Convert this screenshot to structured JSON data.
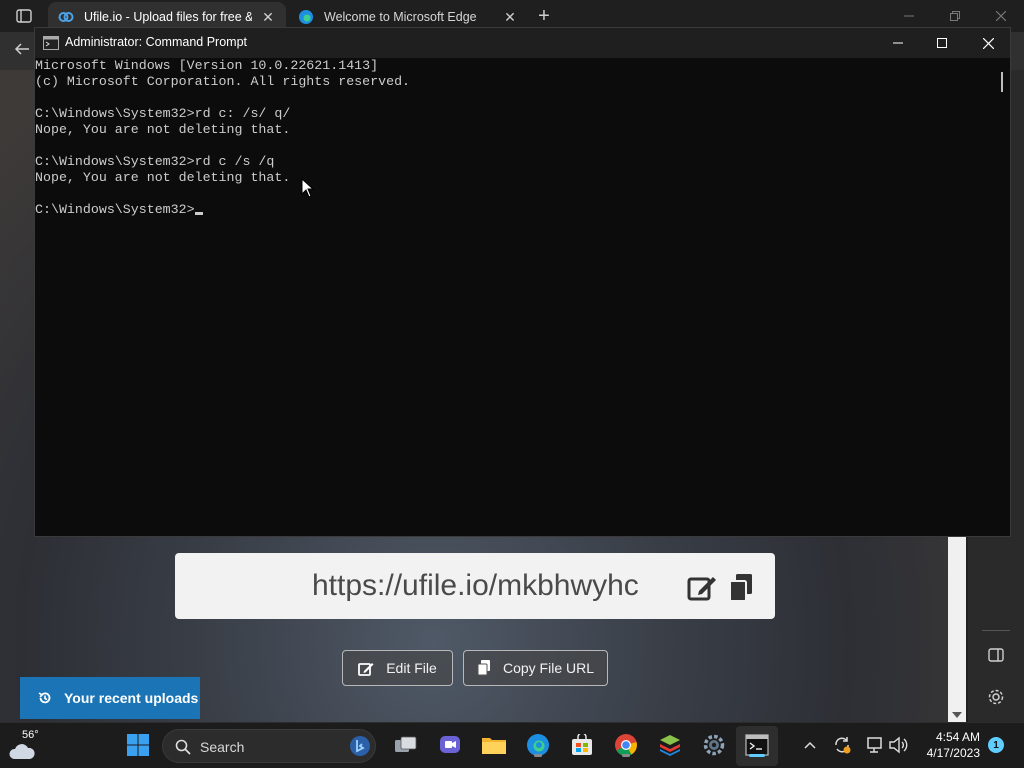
{
  "browser": {
    "tabs": [
      {
        "title": "Ufile.io - Upload files for free & s",
        "active": true
      },
      {
        "title": "Welcome to Microsoft Edge",
        "active": false
      }
    ]
  },
  "page": {
    "file_url": "https://ufile.io/mkbhwyhc",
    "edit_file_label": "Edit File",
    "copy_url_label": "Copy File URL",
    "recent_uploads_label": "Your recent uploads"
  },
  "cmd": {
    "title": "Administrator: Command Prompt",
    "lines": [
      "Microsoft Windows [Version 10.0.22621.1413]",
      "(c) Microsoft Corporation. All rights reserved.",
      "",
      "C:\\Windows\\System32>rd c: /s/ q/",
      "Nope, You are not deleting that.",
      "",
      "C:\\Windows\\System32>rd c /s /q",
      "Nope, You are not deleting that.",
      "",
      "C:\\Windows\\System32>"
    ]
  },
  "taskbar": {
    "weather_temp": "56°",
    "search_label": "Search",
    "time": "4:54 AM",
    "date": "4/17/2023",
    "notification_count": "1"
  },
  "colors": {
    "accent": "#60cdff",
    "ufile_blue": "#1a74b5",
    "console_bg": "#0c0c0c",
    "console_text": "#cccccc"
  }
}
